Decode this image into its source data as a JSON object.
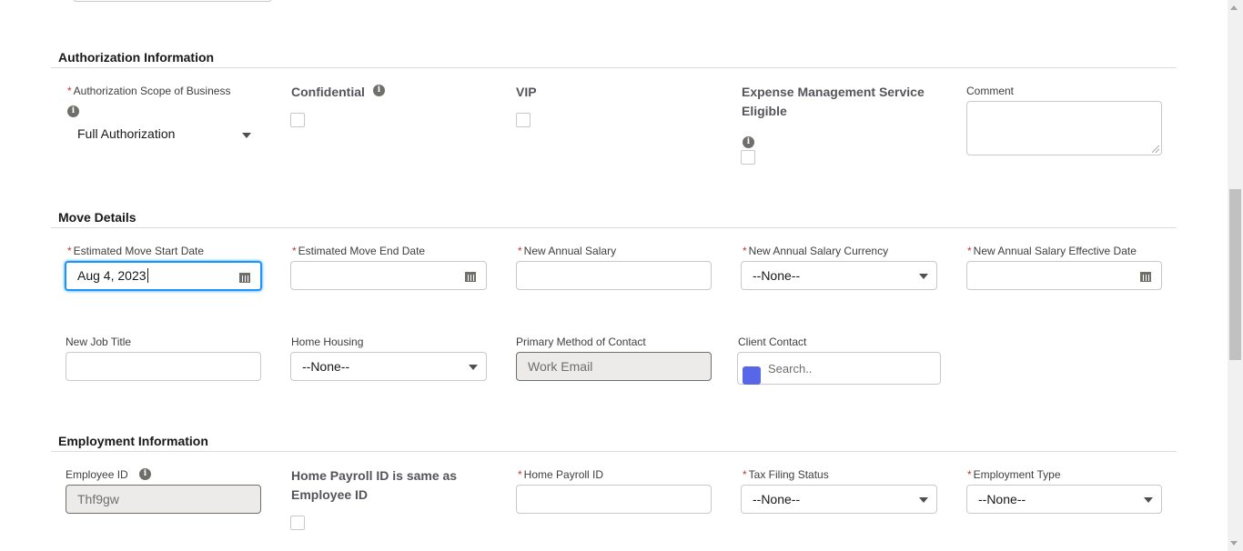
{
  "authorization": {
    "section_title": "Authorization Information",
    "scope_label": "Authorization Scope of Business",
    "scope_value": "Full Authorization",
    "confidential_label": "Confidential",
    "vip_label": "VIP",
    "expense_label_line1": "Expense Management Service",
    "expense_label_line2": "Eligible",
    "comment_label": "Comment"
  },
  "move_details": {
    "section_title": "Move Details",
    "start_date_label": "Estimated Move Start Date",
    "start_date_value": "Aug 4, 2023",
    "end_date_label": "Estimated Move End Date",
    "end_date_value": "",
    "salary_label": "New Annual Salary",
    "salary_value": "",
    "currency_label": "New Annual Salary Currency",
    "currency_value": "--None--",
    "effective_date_label": "New Annual Salary Effective Date",
    "effective_date_value": "",
    "job_title_label": "New Job Title",
    "job_title_value": "",
    "home_housing_label": "Home Housing",
    "home_housing_value": "--None--",
    "contact_method_label": "Primary Method of Contact",
    "contact_method_value": "Work Email",
    "client_contact_label": "Client Contact",
    "client_contact_placeholder": "Search.."
  },
  "employment": {
    "section_title": "Employment Information",
    "employee_id_label": "Employee ID",
    "employee_id_value": "Thf9gw",
    "same_id_label_line1": "Home Payroll ID is same as",
    "same_id_label_line2": "Employee ID",
    "payroll_id_label": "Home Payroll ID",
    "payroll_id_value": "",
    "tax_status_label": "Tax Filing Status",
    "tax_status_value": "--None--",
    "employment_type_label": "Employment Type",
    "employment_type_value": "--None--"
  },
  "required_marker": "*",
  "info_glyph": "i",
  "colors": {
    "required": "#c23934",
    "focus": "#1b96ff",
    "lookup_icon": "#5867e8"
  }
}
